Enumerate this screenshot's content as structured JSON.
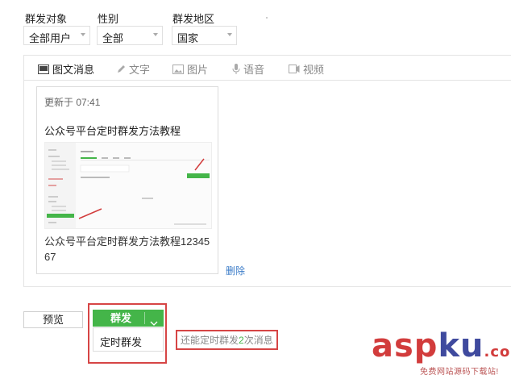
{
  "filters": [
    {
      "label": "群发对象",
      "value": "全部用户"
    },
    {
      "label": "性别",
      "value": "全部"
    },
    {
      "label": "群发地区",
      "value": "国家"
    }
  ],
  "tabs": [
    {
      "label": "图文消息",
      "icon": "image-text-icon",
      "active": true
    },
    {
      "label": "文字",
      "icon": "pencil-icon",
      "active": false
    },
    {
      "label": "图片",
      "icon": "picture-icon",
      "active": false
    },
    {
      "label": "语音",
      "icon": "microphone-icon",
      "active": false
    },
    {
      "label": "视频",
      "icon": "video-icon",
      "active": false
    }
  ],
  "card": {
    "updated": "更新于 07:41",
    "title": "公众号平台定时群发方法教程",
    "description": "公众号平台定时群发方法教程1234567"
  },
  "actions": {
    "delete": "删除",
    "preview": "预览",
    "send": "群发",
    "dropdown_item": "定时群发"
  },
  "quota": {
    "prefix": "还能定时群发",
    "count": "2",
    "suffix": "次消息"
  },
  "watermark": {
    "asp": "asp",
    "ku": "ku",
    "com": ".com",
    "sub": "免费网站源码下载站!"
  },
  "colors": {
    "accent_green": "#44b549",
    "highlight_red": "#d64545",
    "link_blue": "#3a7bc8"
  }
}
